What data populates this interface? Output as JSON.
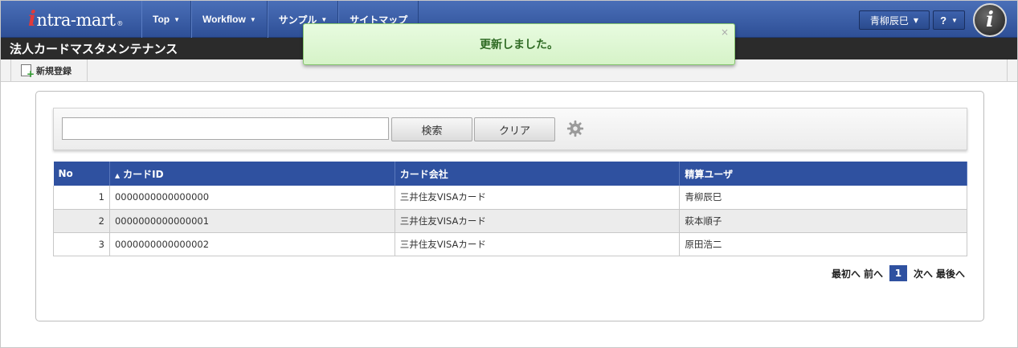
{
  "brand": {
    "logo_i": "i",
    "logo_text": "ntra-mart",
    "logo_mark": "®"
  },
  "nav": {
    "items": [
      {
        "label": "Top"
      },
      {
        "label": "Workflow"
      },
      {
        "label": "サンプル"
      },
      {
        "label": "サイトマップ"
      }
    ]
  },
  "user": {
    "name": "青柳辰巳",
    "help_label": "?"
  },
  "avatar_letter": "i",
  "page_title": "法人カードマスタメンテナンス",
  "toolbar": {
    "new_label": "新規登録"
  },
  "search": {
    "value": "",
    "search_label": "検索",
    "clear_label": "クリア"
  },
  "table": {
    "headers": {
      "no": "No",
      "card_id": "カードID",
      "company": "カード会社",
      "user": "精算ユーザ"
    },
    "rows": [
      {
        "no": "1",
        "card_id": "0000000000000000",
        "company": "三井住友VISAカード",
        "user": "青柳辰巳"
      },
      {
        "no": "2",
        "card_id": "0000000000000001",
        "company": "三井住友VISAカード",
        "user": "萩本順子"
      },
      {
        "no": "3",
        "card_id": "0000000000000002",
        "company": "三井住友VISAカード",
        "user": "原田浩二"
      }
    ]
  },
  "pager": {
    "first": "最初へ",
    "prev": "前へ",
    "current": "1",
    "next": "次へ",
    "last": "最後へ"
  },
  "toast": {
    "message": "更新しました。",
    "close": "×"
  }
}
